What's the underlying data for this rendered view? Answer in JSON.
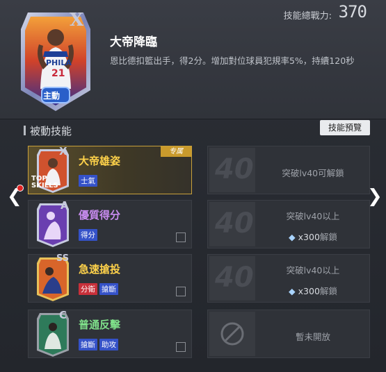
{
  "header": {
    "power_label": "技能總戰力:",
    "power_value": "370"
  },
  "main_skill": {
    "card_rank": "X",
    "jersey_team": "PHILA",
    "jersey_number": "21",
    "badge": "主動",
    "title": "大帝降臨",
    "description": "恩比德扣籃出手，得2分。增加對位球員犯規率5%，持續120秒"
  },
  "section": {
    "title": "被動技能",
    "preview_button": "技能預覽"
  },
  "nav": {
    "left_arrow": "❮",
    "right_arrow": "❯"
  },
  "passive_skills": [
    {
      "name": "大帝雄姿",
      "name_color": "#ffd24a",
      "rank": "X",
      "card_caption": "TOP SKILLS",
      "tags": [
        {
          "label": "士氣",
          "color": "#3552c8"
        }
      ],
      "exclusive": "专属",
      "lock_level": "40",
      "unlock_text": "突破lv40可解鎖",
      "cost": ""
    },
    {
      "name": "優質得分",
      "name_color": "#c98cf0",
      "rank": "A",
      "tags": [
        {
          "label": "得分",
          "color": "#3552c8"
        }
      ],
      "lock_level": "40",
      "unlock_text": "突破lv40以上",
      "cost": "x300",
      "cost_unit": "解鎖"
    },
    {
      "name": "急速搶投",
      "name_color": "#ffd24a",
      "rank": "SS",
      "tags": [
        {
          "label": "分衛",
          "color": "#c8303a"
        },
        {
          "label": "搶斷",
          "color": "#3552c8"
        }
      ],
      "lock_level": "40",
      "unlock_text": "突破lv40以上",
      "cost": "x300",
      "cost_unit": "解鎖"
    },
    {
      "name": "普通反擊",
      "name_color": "#7fe08a",
      "rank": "C",
      "tags": [
        {
          "label": "搶斷",
          "color": "#3552c8"
        },
        {
          "label": "助攻",
          "color": "#3552c8"
        }
      ],
      "unlock_text": "暫未開放",
      "cost": ""
    }
  ]
}
